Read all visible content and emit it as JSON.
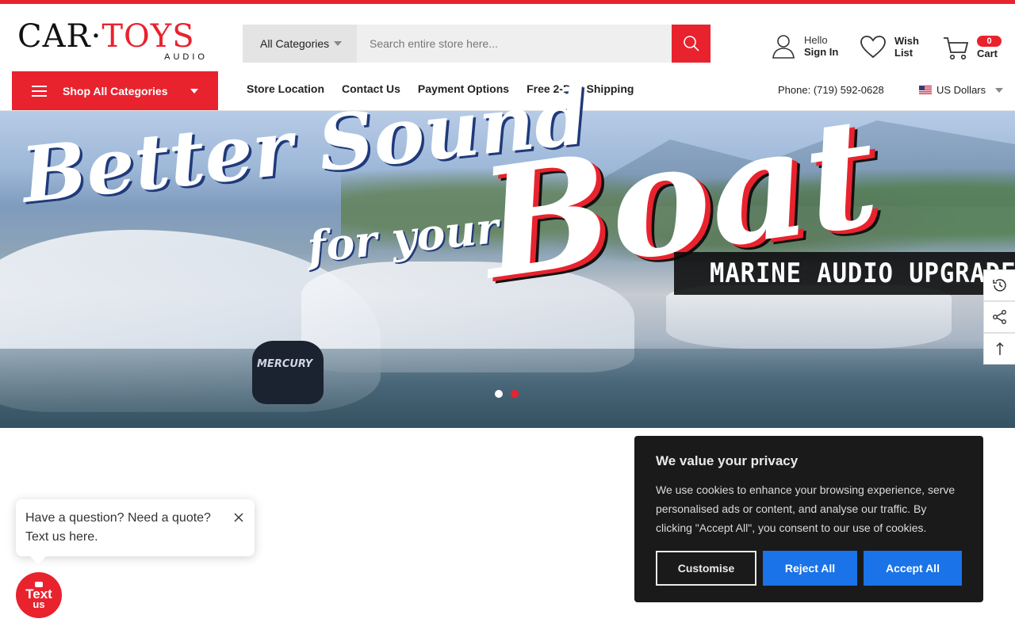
{
  "brand": {
    "logo_part1": "CAR",
    "logo_dot": "·",
    "logo_part2": "TOYS",
    "logo_sub": "AUDIO",
    "accent_color": "#e8232e"
  },
  "search": {
    "category": "All Categories",
    "placeholder": "Search entire store here...",
    "icon": "search-icon"
  },
  "account": {
    "line1": "Hello",
    "line2": "Sign In",
    "icon": "user-icon"
  },
  "wishlist": {
    "line1": "Wish",
    "line2": "List",
    "icon": "heart-icon"
  },
  "cart": {
    "count": "0",
    "label": "Cart",
    "icon": "cart-icon"
  },
  "nav": {
    "shop_all": "Shop All Categories",
    "links": [
      "Store Location",
      "Contact Us",
      "Payment Options",
      "Free 2-Day Shipping"
    ],
    "phone": "Phone: (719) 592-0628",
    "currency": "US Dollars"
  },
  "hero": {
    "line1": "Better Sound",
    "line2": "for your",
    "line3": "Boat",
    "band": "MARINE AUDIO UPGRADES",
    "motor_label": "MERCURY",
    "active_slide": 2,
    "slide_count": 2
  },
  "side_tools": [
    "history-icon",
    "share-icon",
    "arrow-up-icon"
  ],
  "chat": {
    "message": "Have a question? Need a quote? Text us here.",
    "button_line1": "Text",
    "button_line2": "us"
  },
  "cookie": {
    "title": "We value your privacy",
    "body": "We use cookies to enhance your browsing experience, serve personalised ads or content, and analyse our traffic. By clicking \"Accept All\", you consent to our use of cookies.",
    "customise": "Customise",
    "reject": "Reject All",
    "accept": "Accept All",
    "button_color": "#1a73e8"
  }
}
